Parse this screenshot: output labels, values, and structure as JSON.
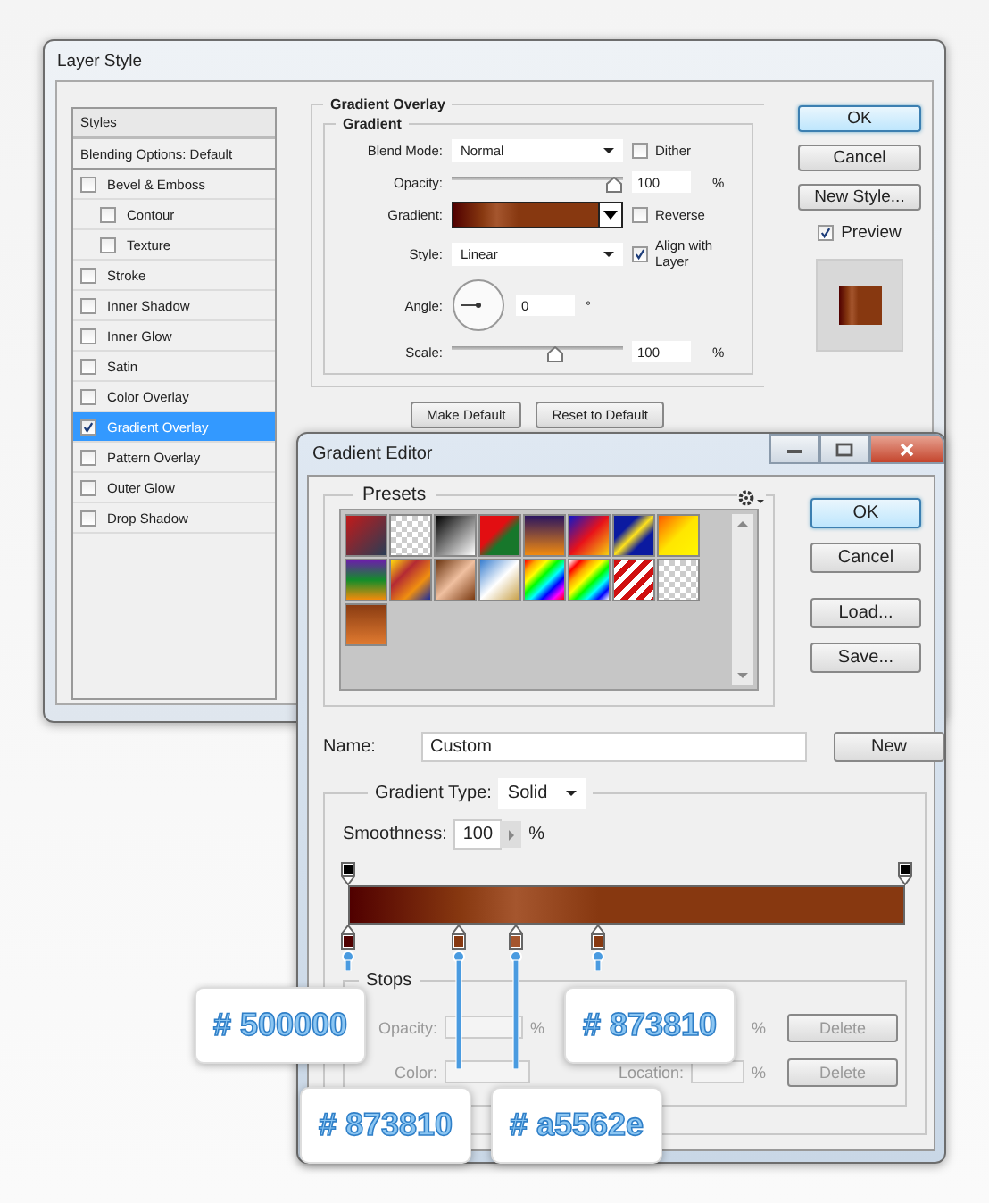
{
  "layer_style": {
    "title": "Layer Style",
    "styles": {
      "header": "Styles",
      "items": [
        {
          "label": "Blending Options: Default",
          "kind": "header",
          "selected": false
        },
        {
          "label": "Bevel & Emboss",
          "kind": "check",
          "checked": false,
          "selected": false,
          "children": [
            {
              "label": "Contour",
              "kind": "check",
              "checked": false,
              "selected": false
            },
            {
              "label": "Texture",
              "kind": "check",
              "checked": false,
              "selected": false
            }
          ]
        },
        {
          "label": "Stroke",
          "kind": "check",
          "checked": false,
          "selected": false
        },
        {
          "label": "Inner Shadow",
          "kind": "check",
          "checked": false,
          "selected": false
        },
        {
          "label": "Inner Glow",
          "kind": "check",
          "checked": false,
          "selected": false
        },
        {
          "label": "Satin",
          "kind": "check",
          "checked": false,
          "selected": false
        },
        {
          "label": "Color Overlay",
          "kind": "check",
          "checked": false,
          "selected": false
        },
        {
          "label": "Gradient Overlay",
          "kind": "check",
          "checked": true,
          "selected": true
        },
        {
          "label": "Pattern Overlay",
          "kind": "check",
          "checked": false,
          "selected": false
        },
        {
          "label": "Outer Glow",
          "kind": "check",
          "checked": false,
          "selected": false
        },
        {
          "label": "Drop Shadow",
          "kind": "check",
          "checked": false,
          "selected": false
        }
      ]
    },
    "overlay": {
      "legend": "Gradient Overlay",
      "group": "Gradient",
      "blend_mode": {
        "label": "Blend Mode:",
        "value": "Normal"
      },
      "dither": {
        "label": "Dither",
        "checked": false
      },
      "opacity": {
        "label": "Opacity:",
        "level": 1,
        "value": "100",
        "unit": "%"
      },
      "gradient": {
        "label": "Gradient:"
      },
      "reverse": {
        "label": "Reverse",
        "checked": false
      },
      "style": {
        "label": "Style:",
        "value": "Linear"
      },
      "align": {
        "label": "Align with Layer",
        "checked": true
      },
      "angle": {
        "label": "Angle:",
        "value": "0",
        "unit": "°"
      },
      "scale": {
        "label": "Scale:",
        "level": 0.62,
        "value": "100",
        "unit": "%"
      },
      "buttons": [
        "Make Default",
        "Reset to Default"
      ]
    },
    "buttons": [
      {
        "label": "OK",
        "default": true
      },
      {
        "label": "Cancel",
        "default": false
      },
      {
        "label": "New Style...",
        "default": false
      }
    ],
    "preview": {
      "label": "Preview",
      "checked": true
    }
  },
  "gradient_editor": {
    "title": "Gradient Editor",
    "presets_legend": "Presets",
    "buttons": [
      {
        "label": "OK",
        "default": true
      },
      {
        "label": "Cancel",
        "default": false
      },
      {
        "label": "Load...",
        "default": false
      },
      {
        "label": "Save...",
        "default": false
      }
    ],
    "name": {
      "label": "Name:",
      "value": "Custom"
    },
    "new_button": "New",
    "gradient_type": {
      "label": "Gradient Type:",
      "value": "Solid"
    },
    "smoothness": {
      "label": "Smoothness:",
      "value": "100",
      "unit": "%"
    },
    "opacity_stops": [
      {
        "level": 0,
        "color": "#000000"
      },
      {
        "level": 1,
        "color": "#000000"
      }
    ],
    "color_stops": [
      {
        "level": 0,
        "color": "#500000",
        "callout": "# 500000"
      },
      {
        "level": 0.2,
        "color": "#873810",
        "callout": "# 873810"
      },
      {
        "level": 0.3,
        "color": "#a5562e",
        "callout": "# a5562e"
      },
      {
        "level": 0.45,
        "color": "#873810",
        "callout": "# 873810"
      }
    ],
    "stops": {
      "legend": "Stops",
      "opacity_label": "Opacity:",
      "opacity_unit": "%",
      "color_label": "Color:",
      "location_label": "Location:",
      "location_unit": "%",
      "location_unit_2": "%",
      "delete": [
        "Delete",
        "Delete"
      ]
    }
  }
}
